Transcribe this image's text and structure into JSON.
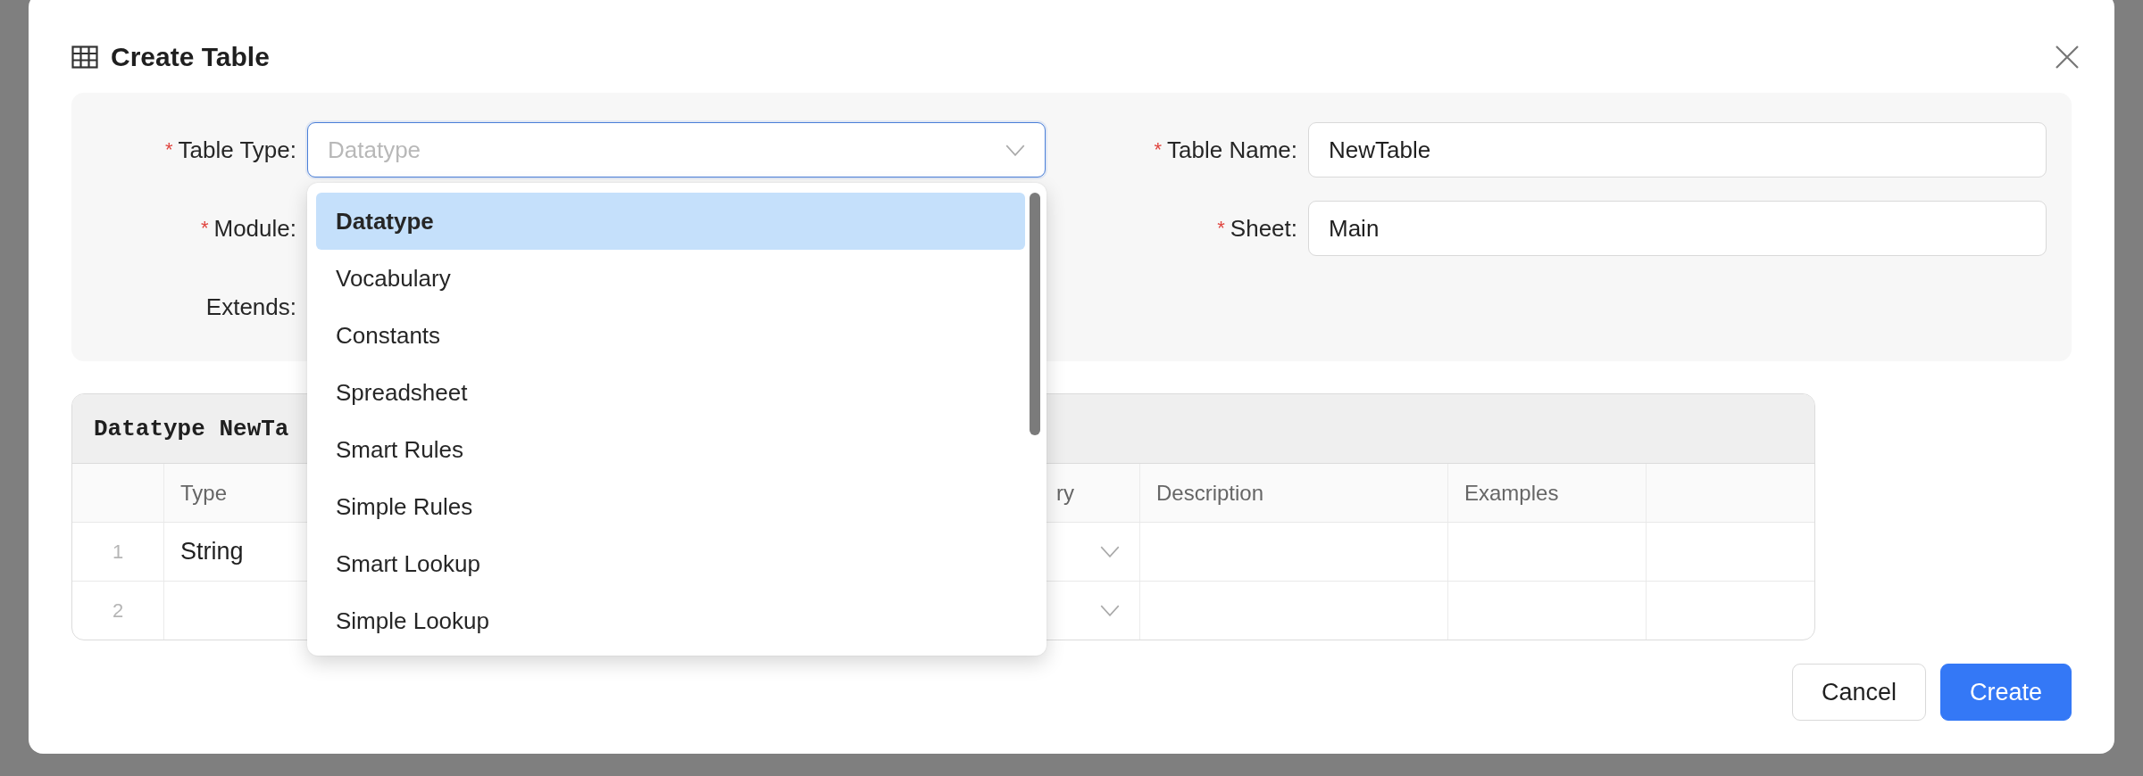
{
  "dialog": {
    "title": "Create Table"
  },
  "form": {
    "rows": [
      [
        {
          "label": "Table Type:",
          "marker": "*",
          "kind": "select",
          "placeholder": "Datatype",
          "focused": true
        },
        {
          "label": "Table Name:",
          "marker": "*",
          "kind": "text",
          "value": "NewTable"
        }
      ],
      [
        {
          "label": "Module:",
          "marker": "*",
          "kind": "covered"
        },
        {
          "label": "Sheet:",
          "marker": "*",
          "kind": "text",
          "value": "Main"
        }
      ],
      [
        {
          "label": "Extends:",
          "kind": "covered"
        }
      ]
    ]
  },
  "dropdown": {
    "options": [
      {
        "label": "Datatype",
        "selected": true
      },
      {
        "label": "Vocabulary",
        "selected": false
      },
      {
        "label": "Constants",
        "selected": false
      },
      {
        "label": "Spreadsheet",
        "selected": false
      },
      {
        "label": "Smart Rules",
        "selected": false
      },
      {
        "label": "Simple Rules",
        "selected": false
      },
      {
        "label": "Smart Lookup",
        "selected": false
      },
      {
        "label": "Simple Lookup",
        "selected": false
      }
    ]
  },
  "table": {
    "caption": "Datatype NewTa",
    "columns": [
      {
        "kind": "number"
      },
      {
        "kind": "text",
        "label": "Type"
      },
      {
        "kind": "covered"
      },
      {
        "kind": "select",
        "label": "ry"
      },
      {
        "kind": "text",
        "label": "Description"
      },
      {
        "kind": "text",
        "label": "Examples"
      },
      {
        "kind": "blank"
      }
    ],
    "rows": [
      {
        "number": "1",
        "type": "String"
      },
      {
        "number": "2"
      }
    ]
  },
  "buttons": [
    {
      "label": "Cancel",
      "kind": "default"
    },
    {
      "label": "Create",
      "kind": "primary"
    }
  ]
}
